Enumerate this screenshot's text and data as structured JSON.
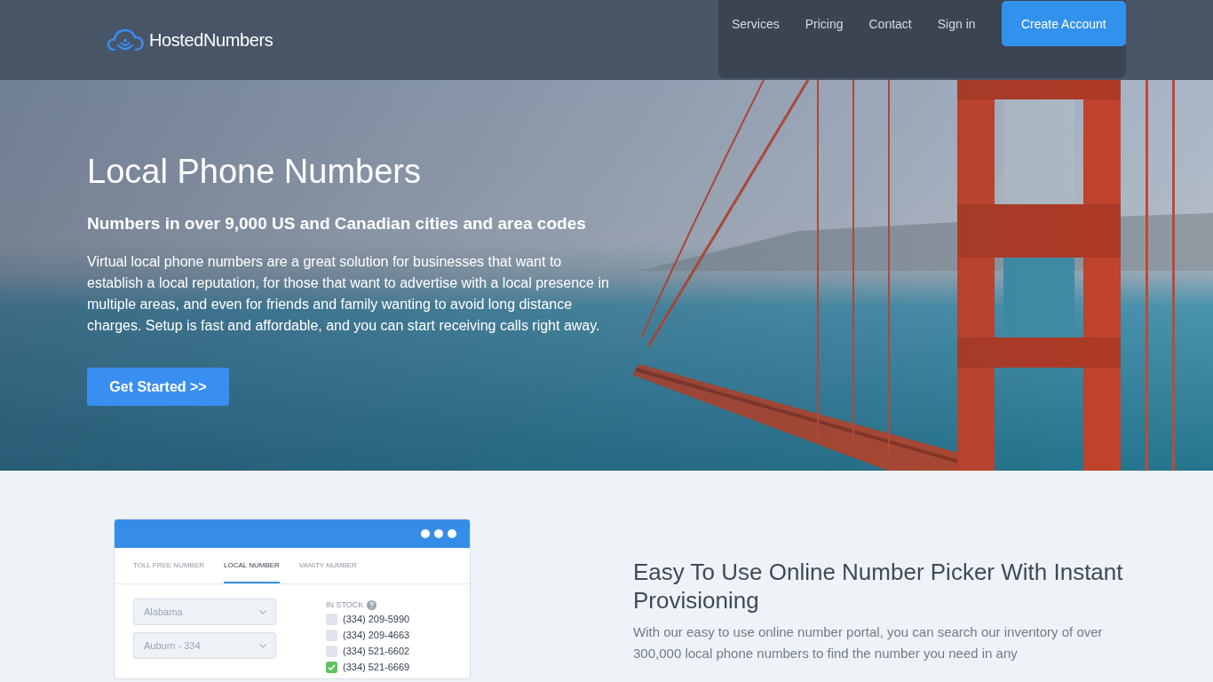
{
  "header": {
    "logo": {
      "text": "HostedNumbers"
    },
    "nav": [
      {
        "label": "Services"
      },
      {
        "label": "Pricing"
      },
      {
        "label": "Contact"
      },
      {
        "label": "Sign in"
      }
    ],
    "cta": {
      "label": "Create Account"
    }
  },
  "hero": {
    "title": "Local Phone Numbers",
    "subtitle": "Numbers in over 9,000 US and Canadian cities and area codes",
    "body": "Virtual local phone numbers are a great solution for businesses that want to establish a local reputation, for those that want to advertise with a local presence in multiple areas, and even for friends and family wanting to avoid long distance charges. Setup is fast and affordable, and you can start receiving calls right away.",
    "button": {
      "label": "Get Started >>"
    }
  },
  "picker": {
    "tabs": [
      {
        "label": "TOLL FREE NUMBER",
        "selected": false
      },
      {
        "label": "LOCAL NUMBER",
        "selected": true
      },
      {
        "label": "VANITY NUMBER",
        "selected": false
      }
    ],
    "selects": [
      {
        "value": "Alabama"
      },
      {
        "value": "Auburn - 334"
      }
    ],
    "stock_label": "IN STOCK",
    "numbers": [
      {
        "number": "(334) 209-5990",
        "checked": false
      },
      {
        "number": "(334) 209-4663",
        "checked": false
      },
      {
        "number": "(334) 521-6602",
        "checked": false
      },
      {
        "number": "(334) 521-6669",
        "checked": true
      }
    ]
  },
  "feature": {
    "title": "Easy To Use Online Number Picker With Instant Provisioning",
    "body": "With our easy to use online number portal, you can search our inventory of over 300,000 local phone numbers to find the number you need in any"
  }
}
